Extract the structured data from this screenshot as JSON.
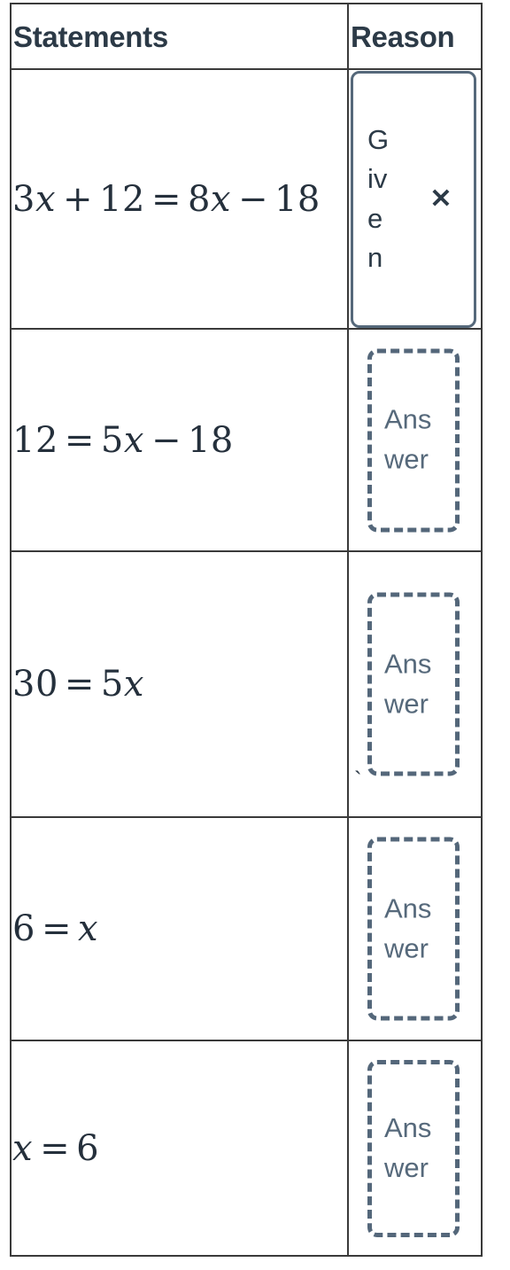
{
  "table": {
    "headers": {
      "statements": "Statements",
      "reason": "Reason"
    },
    "rows": [
      {
        "statement": {
          "full": "3x + 12 = 8x - 18",
          "parts": [
            "3",
            "x",
            "+",
            "12",
            "=",
            "8",
            "x",
            "−",
            "18"
          ]
        },
        "reason": {
          "kind": "chip",
          "label": "Given",
          "remove_icon": "✕",
          "filled": true
        }
      },
      {
        "statement": {
          "full": "12 = 5x - 18",
          "parts": [
            "12",
            "=",
            "5",
            "x",
            "−",
            "18"
          ]
        },
        "reason": {
          "kind": "dropzone",
          "label": "Answer",
          "filled": false
        }
      },
      {
        "statement": {
          "full": "30 = 5x",
          "parts": [
            "30",
            "=",
            "5",
            "x"
          ]
        },
        "reason": {
          "kind": "dropzone",
          "label": "Answer",
          "filled": false,
          "stray_mark": "`"
        }
      },
      {
        "statement": {
          "full": "6 = x",
          "parts": [
            "6",
            "=",
            "x"
          ]
        },
        "reason": {
          "kind": "dropzone",
          "label": "Answer",
          "filled": false
        }
      },
      {
        "statement": {
          "full": "x = 6",
          "parts": [
            "x",
            "=",
            "6"
          ]
        },
        "reason": {
          "kind": "dropzone",
          "label": "Answer",
          "filled": false
        }
      }
    ]
  },
  "colors": {
    "text": "#2c3a47",
    "math_text": "#25303c",
    "table_border": "#3a3a3a",
    "chip_border": "#55687a",
    "dropzone_border": "#54677a",
    "dropzone_text": "#56697b",
    "background": "#ffffff"
  },
  "math": {
    "r1": {
      "n1": "3",
      "v1": "x",
      "op1": "+",
      "n2": "12",
      "eq": "=",
      "n3": "8",
      "v2": "x",
      "op2": "−",
      "n4": "18"
    },
    "r2": {
      "n1": "12",
      "eq": "=",
      "n2": "5",
      "v1": "x",
      "op1": "−",
      "n3": "18"
    },
    "r3": {
      "n1": "30",
      "eq": "=",
      "n2": "5",
      "v1": "x"
    },
    "r4": {
      "n1": "6",
      "eq": "=",
      "v1": "x"
    },
    "r5": {
      "v1": "x",
      "eq": "=",
      "n1": "6"
    }
  }
}
